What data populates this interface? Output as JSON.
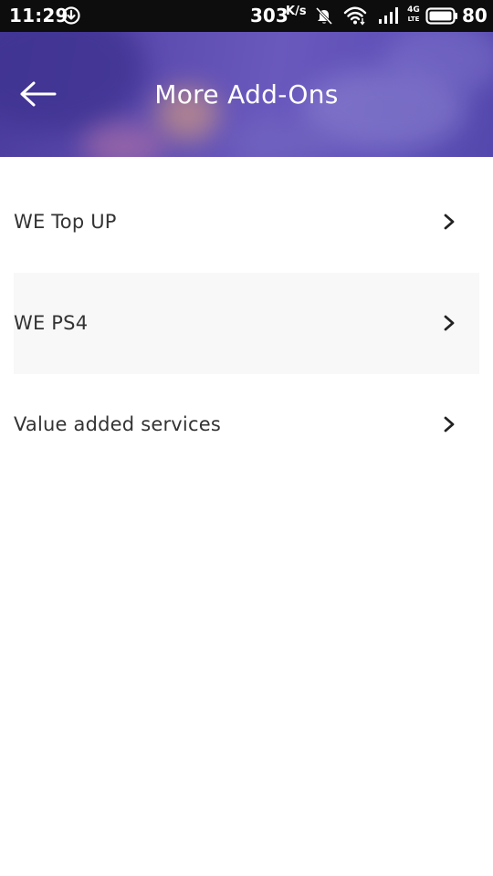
{
  "status_bar": {
    "time": "11:29",
    "speed_value": "303",
    "speed_unit": "K/s",
    "net_type_top": "4G",
    "net_type_bottom": "LTE",
    "battery_level": "80"
  },
  "header": {
    "title": "More Add-Ons",
    "back_icon": "arrow-left-icon"
  },
  "list": {
    "items": [
      {
        "label": "WE Top UP",
        "icon": "chevron-right-icon"
      },
      {
        "label": "WE PS4",
        "icon": "chevron-right-icon"
      },
      {
        "label": "Value added services",
        "icon": "chevron-right-icon"
      }
    ]
  },
  "colors": {
    "header_primary": "#5d4cb0",
    "list_alt_background": "#f8f8f8",
    "text": "#333333"
  }
}
